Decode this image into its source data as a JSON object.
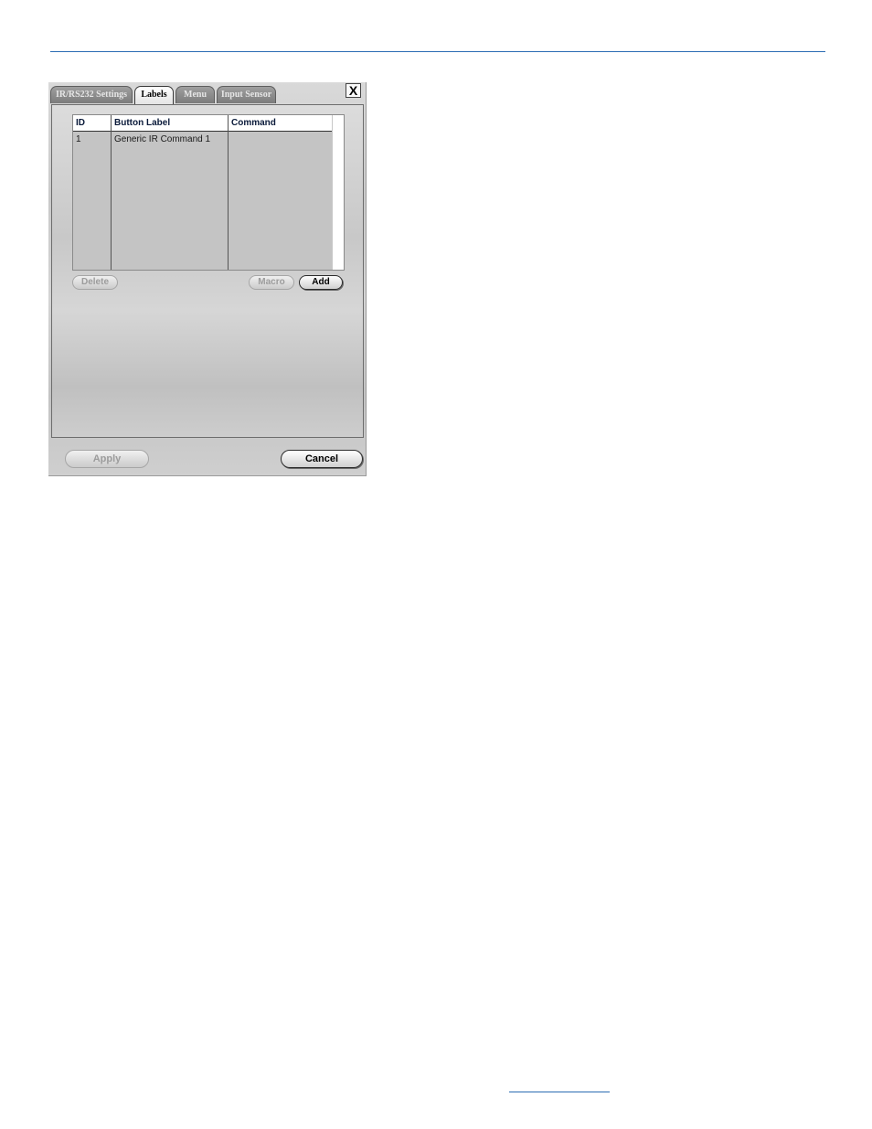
{
  "dialog": {
    "tabs": [
      {
        "label": "IR/RS232 Settings",
        "active": false
      },
      {
        "label": "Labels",
        "active": true
      },
      {
        "label": "Menu",
        "active": false
      },
      {
        "label": "Input Sensor",
        "active": false
      }
    ],
    "close_label": "X",
    "table": {
      "columns": [
        "ID",
        "Button Label",
        "Command"
      ],
      "rows": [
        {
          "id": "1",
          "label": "Generic IR Command 1",
          "command": ""
        }
      ]
    },
    "buttons": {
      "delete": "Delete",
      "macro": "Macro",
      "add": "Add",
      "apply": "Apply",
      "cancel": "Cancel"
    }
  }
}
